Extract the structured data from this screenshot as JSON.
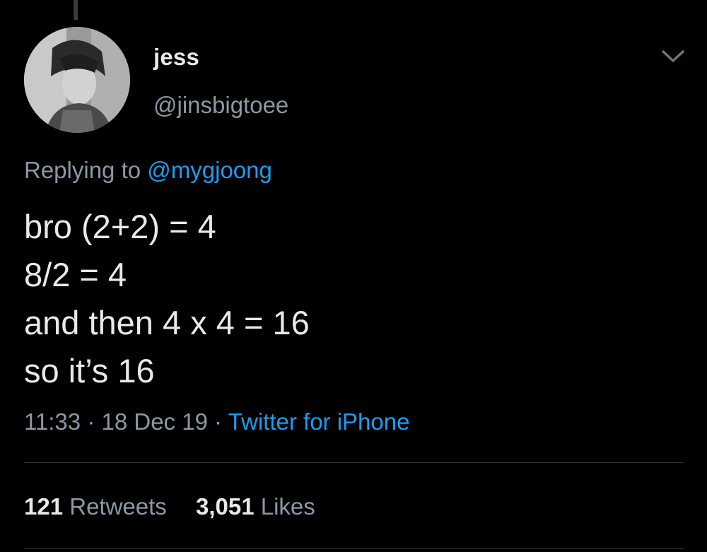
{
  "user": {
    "display_name": "jess",
    "handle": "@jinsbigtoee"
  },
  "reply": {
    "prefix": "Replying to",
    "mention": "@mygjoong"
  },
  "tweet": {
    "lines": [
      "bro (2+2) = 4",
      "8/2 = 4",
      "and then 4 x 4 = 16",
      "so it’s 16"
    ]
  },
  "meta": {
    "time": "11:33",
    "separator": "·",
    "date": "18 Dec 19",
    "source": "Twitter for iPhone"
  },
  "stats": {
    "retweets_count": "121",
    "retweets_label": "Retweets",
    "likes_count": "3,051",
    "likes_label": "Likes"
  },
  "colors": {
    "background": "#000000",
    "primary_text": "#e7e9ea",
    "secondary_text": "#8b98a5",
    "link": "#1d9bf0",
    "divider": "#2f3336"
  },
  "icons": {
    "caret": "chevron-down-icon"
  }
}
